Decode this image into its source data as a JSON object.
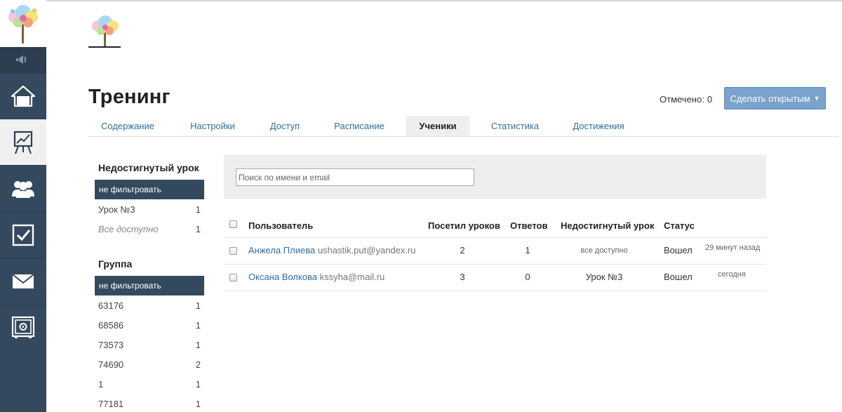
{
  "colors": {
    "sidebar": "#34495e",
    "accent_button": "#79a2cc",
    "link": "#2f6ea5",
    "filter_selected": "#34495e"
  },
  "sidebar": {
    "items": [
      {
        "icon": "home-icon"
      },
      {
        "icon": "chart-board-icon",
        "active": true
      },
      {
        "icon": "users-icon"
      },
      {
        "icon": "checkbox-icon"
      },
      {
        "icon": "mail-icon"
      },
      {
        "icon": "safe-icon"
      }
    ]
  },
  "page": {
    "title": "Тренинг"
  },
  "header": {
    "marked_label": "Отмечено:",
    "marked_count": "0",
    "open_button_label": "Сделать открытым"
  },
  "tabs": [
    {
      "label": "Содержание"
    },
    {
      "label": "Настройки"
    },
    {
      "label": "Доступ"
    },
    {
      "label": "Расписание"
    },
    {
      "label": "Ученики",
      "active": true
    },
    {
      "label": "Статистика"
    },
    {
      "label": "Достижения"
    }
  ],
  "filters": {
    "lesson": {
      "title": "Недостигнутый урок",
      "selected": "не фильтровать",
      "items": [
        {
          "name": "Урок №3",
          "count": "1"
        },
        {
          "name": "Все доступно",
          "count": "1"
        }
      ]
    },
    "group": {
      "title": "Группа",
      "selected": "не фильтровать",
      "items": [
        {
          "name": "63176",
          "count": "1"
        },
        {
          "name": "68586",
          "count": "1"
        },
        {
          "name": "73573",
          "count": "1"
        },
        {
          "name": "74690",
          "count": "2"
        },
        {
          "name": "1",
          "count": "1"
        },
        {
          "name": "77181",
          "count": "1"
        }
      ]
    }
  },
  "search": {
    "placeholder": "Поиск по имени и email"
  },
  "table": {
    "headers": {
      "user": "Пользователь",
      "visited": "Посетил уроков",
      "answers": "Ответов",
      "unreached": "Недостигнутый урок",
      "status": "Статус"
    },
    "rows": [
      {
        "name": "Анжела Плиева",
        "email": "ushastik.put@yandex.ru",
        "visited": "2",
        "answers": "1",
        "unreached": "все доступно",
        "status": "Вошел",
        "time": "29 минут назад"
      },
      {
        "name": "Оксана Волкова",
        "email": "kssyha@mail.ru",
        "visited": "3",
        "answers": "0",
        "unreached": "Урок №3",
        "status": "Вошел",
        "time": "сегодня"
      }
    ]
  }
}
